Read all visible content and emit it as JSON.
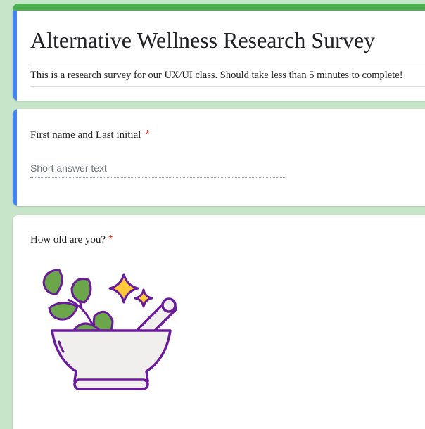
{
  "form": {
    "title": "Alternative Wellness Research Survey",
    "description": "This is a research survey for our UX/UI class. Should take less than 5 minutes to complete!",
    "accent_color": "#4caf50",
    "focus_color": "#4285f4",
    "background_color": "#c7e5c8"
  },
  "questions": [
    {
      "title": "First name and Last initial",
      "required_mark": "*",
      "type": "short_answer",
      "placeholder": "Short answer text"
    },
    {
      "title": "How old are you?",
      "required_mark": "*",
      "image": "mortar-and-pestle-with-herbs-illustration"
    }
  ]
}
